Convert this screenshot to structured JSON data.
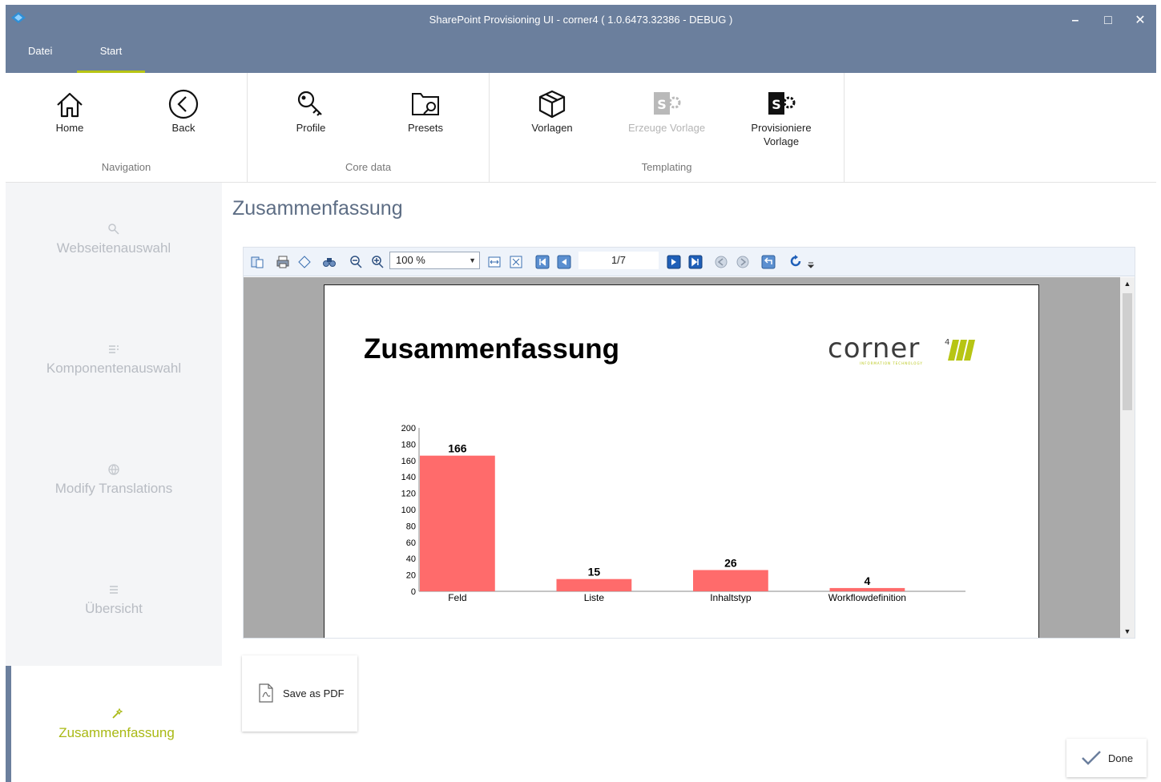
{
  "window": {
    "title": "SharePoint Provisioning UI - corner4 ( 1.0.6473.32386 - DEBUG )",
    "controls": {
      "minimize": "–",
      "maximize": "□",
      "close": "✕"
    }
  },
  "menu": {
    "tabs": [
      {
        "label": "Datei"
      },
      {
        "label": "Start"
      }
    ]
  },
  "ribbon": {
    "groups": [
      {
        "label": "Navigation",
        "buttons": [
          {
            "label": "Home",
            "icon": "home-icon"
          },
          {
            "label": "Back",
            "icon": "back-circle-icon"
          }
        ]
      },
      {
        "label": "Core data",
        "buttons": [
          {
            "label": "Profile",
            "icon": "key-icon"
          },
          {
            "label": "Presets",
            "icon": "folder-search-icon"
          }
        ]
      },
      {
        "label": "Templating",
        "buttons": [
          {
            "label": "Vorlagen",
            "icon": "package-icon"
          },
          {
            "label": "Erzeuge Vorlage",
            "icon": "sharepoint-gear-icon",
            "disabled": true
          },
          {
            "label": "Provisioniere Vorlage",
            "label_line1": "Provisioniere",
            "label_line2": "Vorlage",
            "icon": "sharepoint-gear-icon"
          }
        ]
      }
    ]
  },
  "sidebar": {
    "items": [
      {
        "label": "Webseitenauswahl",
        "icon": "search-icon"
      },
      {
        "label": "Komponentenauswahl",
        "icon": "list-icon"
      },
      {
        "label": "Modify Translations",
        "icon": "globe-icon"
      },
      {
        "label": "Übersicht",
        "icon": "list-icon"
      },
      {
        "label": "Zusammenfassung",
        "icon": "wand-icon",
        "active": true
      }
    ]
  },
  "main": {
    "title": "Zusammenfassung"
  },
  "viewer": {
    "zoom": "100 %",
    "page": "1/7",
    "report_title": "Zusammenfassung",
    "logo_text": "corner",
    "logo_sup": "4"
  },
  "chart_data": {
    "type": "bar",
    "categories": [
      "Feld",
      "Liste",
      "Inhaltstyp",
      "Workflowdefinition"
    ],
    "values": [
      166,
      15,
      26,
      4
    ],
    "value_labels": [
      "166",
      "15",
      "26",
      "4"
    ],
    "ylim": [
      0,
      200
    ],
    "yticks": [
      "0",
      "20",
      "40",
      "60",
      "80",
      "100",
      "120",
      "140",
      "160",
      "180",
      "200"
    ],
    "ytick_values": [
      0,
      20,
      40,
      60,
      80,
      100,
      120,
      140,
      160,
      180,
      200
    ],
    "color": "#ff6b6b",
    "title": "",
    "xlabel": "",
    "ylabel": "",
    "grid": false
  },
  "actions": {
    "save_pdf": "Save as PDF",
    "done": "Done"
  },
  "colors": {
    "titlebar": "#6b7f9d",
    "accent": "#b7c514",
    "active_text": "#a9b914",
    "bar": "#ff6b6b"
  }
}
